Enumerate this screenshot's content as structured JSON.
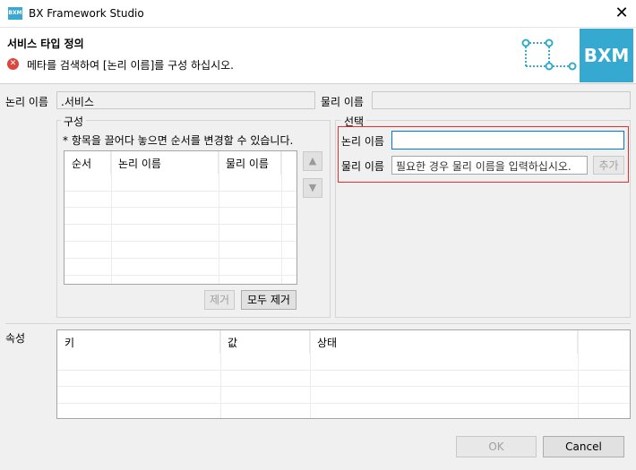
{
  "window": {
    "title": "BX Framework Studio",
    "icon_text": "BXM"
  },
  "header": {
    "title": "서비스 타입 정의",
    "error_message": "메타를 검색하여 [논리 이름]를 구성 하십시오.",
    "logo_text": "BXM"
  },
  "fields": {
    "logical_label": "논리 이름",
    "logical_value": ".서비스",
    "physical_label": "물리 이름",
    "physical_value": ""
  },
  "composition": {
    "title": "구성",
    "hint": "* 항목을 끌어다 놓으면 순서를 변경할 수 있습니다.",
    "columns": [
      "순서",
      "논리 이름",
      "물리 이름"
    ],
    "remove_label": "제거",
    "remove_all_label": "모두 제거"
  },
  "selection": {
    "title": "선택",
    "logical_label": "논리 이름",
    "logical_value": "",
    "physical_label": "물리 이름",
    "physical_placeholder": "필요한 경우 물리 이름을 입력하십시오.",
    "add_label": "추가"
  },
  "properties": {
    "label": "속성",
    "columns": [
      "키",
      "값",
      "상태"
    ]
  },
  "footer": {
    "ok_label": "OK",
    "cancel_label": "Cancel"
  }
}
